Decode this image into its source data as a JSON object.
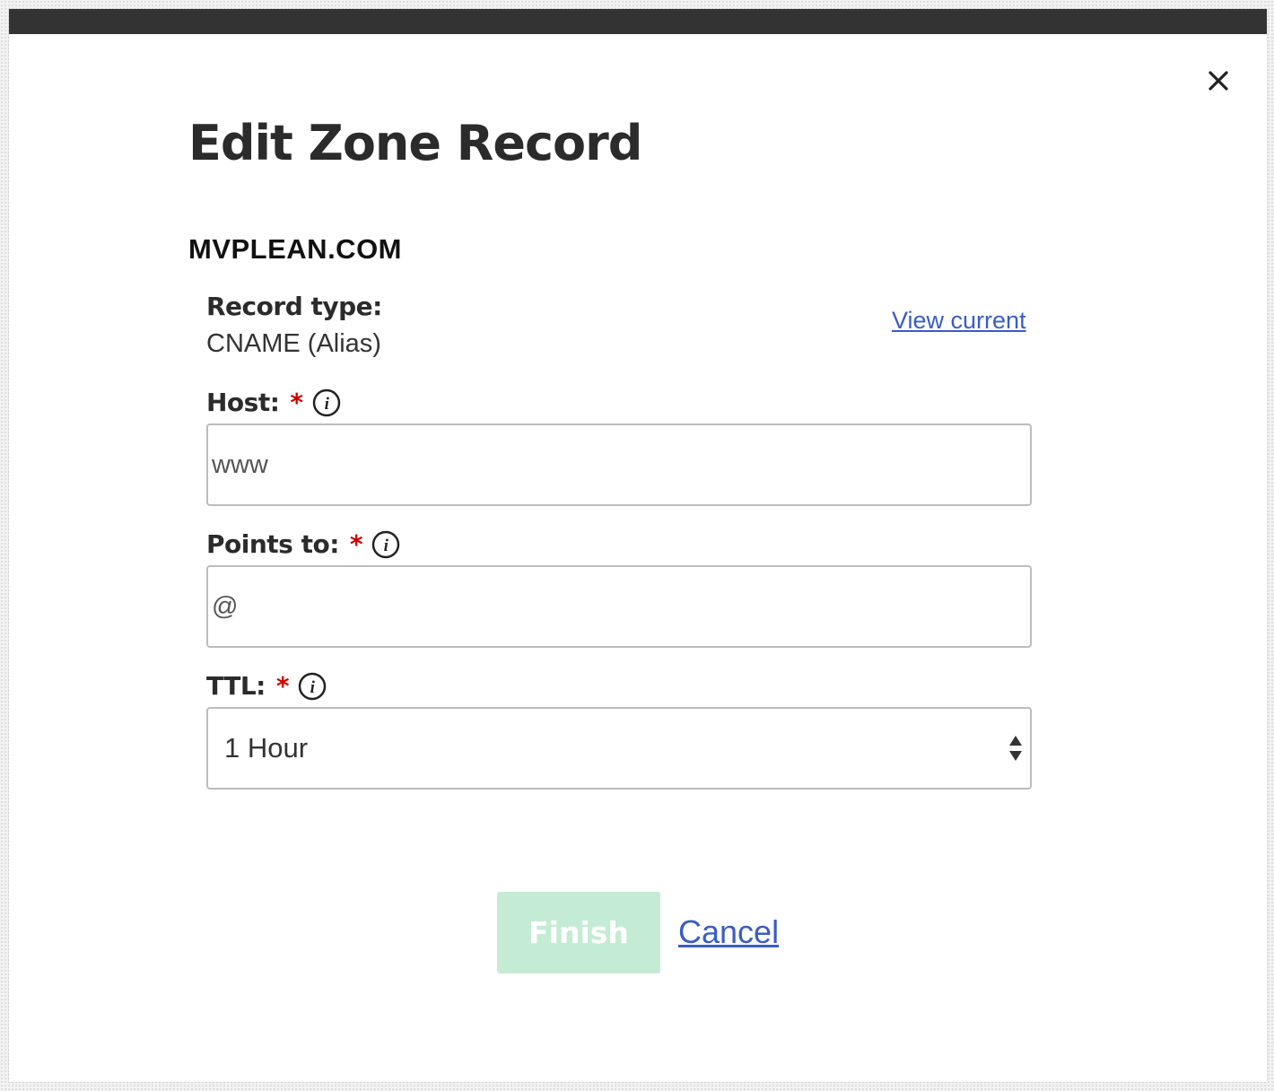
{
  "dialog": {
    "title": "Edit Zone Record",
    "domain": "MVPLEAN.COM",
    "close_icon": "close-icon"
  },
  "record_type": {
    "label": "Record type:",
    "value": "CNAME (Alias)",
    "view_current_link": "View current"
  },
  "host": {
    "label": "Host:",
    "required_marker": "*",
    "value": "www",
    "info_icon": "info-icon"
  },
  "points_to": {
    "label": "Points to:",
    "required_marker": "*",
    "value": "@",
    "info_icon": "info-icon"
  },
  "ttl": {
    "label": "TTL:",
    "required_marker": "*",
    "selected": "1 Hour",
    "info_icon": "info-icon"
  },
  "actions": {
    "finish_label": "Finish",
    "cancel_label": "Cancel"
  },
  "colors": {
    "title_text": "#2b2b2b",
    "required": "#cc0000",
    "link": "#3b5cc4",
    "finish_disabled_bg": "#c4ebd4",
    "topbar": "#333333"
  }
}
